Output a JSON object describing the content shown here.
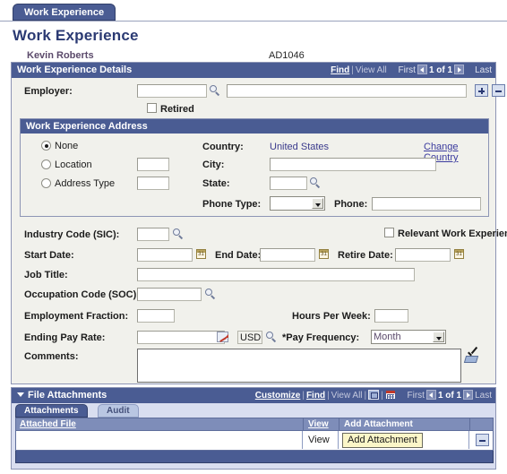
{
  "browser_tab": {
    "label": "Work Experience"
  },
  "page": {
    "title": "Work Experience",
    "employee_name": "Kevin Roberts",
    "employee_id": "AD1046"
  },
  "details_section": {
    "title": "Work Experience Details",
    "nav": {
      "find": "Find",
      "view_all": "View All",
      "first": "First",
      "count": "1 of 1",
      "last": "Last"
    },
    "employer_label": "Employer:",
    "employer_code_value": "",
    "employer_desc_value": "",
    "retired_label": "Retired",
    "retired_checked": false,
    "add_row_label": "+",
    "delete_row_label": "-"
  },
  "address_section": {
    "title": "Work Experience Address",
    "options": [
      {
        "label": "None",
        "selected": true
      },
      {
        "label": "Location",
        "selected": false
      },
      {
        "label": "Address Type",
        "selected": false
      }
    ],
    "location_value": "",
    "address_type_value": "",
    "country_label": "Country:",
    "country_value": "United States",
    "change_country_link": "Change Country",
    "city_label": "City:",
    "city_value": "",
    "state_label": "State:",
    "state_value": "",
    "phone_type_label": "Phone Type:",
    "phone_type_value": "",
    "phone_label": "Phone:",
    "phone_value": ""
  },
  "detail_fields": {
    "industry_code_label": "Industry Code (SIC):",
    "industry_code_value": "",
    "relevant_work_experience_label": "Relevant Work Experience",
    "relevant_work_experience_checked": false,
    "start_date_label": "Start Date:",
    "start_date_value": "",
    "end_date_label": "End Date:",
    "end_date_value": "",
    "retire_date_label": "Retire Date:",
    "retire_date_value": "",
    "job_title_label": "Job Title:",
    "job_title_value": "",
    "occupation_code_label": "Occupation Code (SOC):",
    "occupation_code_value": "",
    "employment_fraction_label": "Employment Fraction:",
    "employment_fraction_value": "",
    "hours_per_week_label": "Hours Per Week:",
    "hours_per_week_value": "",
    "ending_pay_rate_label": "Ending Pay Rate:",
    "ending_pay_rate_value": "",
    "currency_code": "USD",
    "pay_frequency_label": "*Pay Frequency:",
    "pay_frequency_value": "Month",
    "comments_label": "Comments:",
    "comments_value": ""
  },
  "attachments_section": {
    "title": "File Attachments",
    "nav": {
      "customize": "Customize",
      "find": "Find",
      "view_all": "View All",
      "first": "First",
      "count": "1 of 1",
      "last": "Last"
    },
    "tabs": [
      {
        "label": "Attachments",
        "active": true
      },
      {
        "label": "Audit",
        "active": false
      }
    ],
    "columns": [
      "Attached File",
      "View",
      "Add Attachment",
      ""
    ],
    "rows": [
      {
        "attached_file": "",
        "view": "View",
        "add_attachment": "Add Attachment",
        "delete": "-"
      }
    ]
  },
  "colors": {
    "header_blue": "#4a5c93",
    "panel_bg": "#f1f1ec",
    "grid_header": "#7e8db9",
    "accent_link": "#3b3b9e",
    "button_yellow": "#fbf6c8"
  }
}
